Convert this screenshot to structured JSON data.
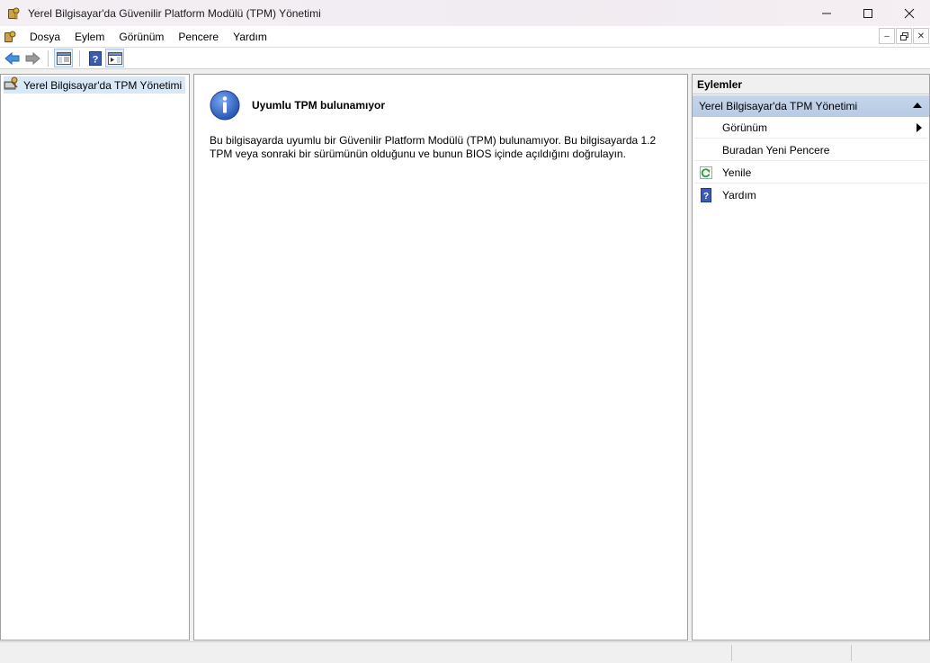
{
  "window": {
    "title": "Yerel Bilgisayar'da Güvenilir Platform Modülü (TPM) Yönetimi",
    "icon": "tpm-key-icon"
  },
  "menu": {
    "items": [
      {
        "label": "Dosya"
      },
      {
        "label": "Eylem"
      },
      {
        "label": "Görünüm"
      },
      {
        "label": "Pencere"
      },
      {
        "label": "Yardım"
      }
    ]
  },
  "toolbar": {
    "buttons": [
      "back-arrow-icon",
      "forward-arrow-icon",
      "show-hide-console-tree-icon",
      "help-icon",
      "show-hide-action-pane-icon"
    ]
  },
  "tree": {
    "root_label": "Yerel Bilgisayar'da TPM Yönetimi"
  },
  "content": {
    "title": "Uyumlu TPM bulunamıyor",
    "body": "Bu bilgisayarda uyumlu bir Güvenilir Platform Modülü (TPM) bulunamıyor. Bu bilgisayarda 1.2 TPM veya sonraki bir sürümünün olduğunu ve bunun BIOS içinde açıldığını doğrulayın."
  },
  "actions": {
    "header": "Eylemler",
    "section_title": "Yerel Bilgisayar'da TPM Yönetimi",
    "items": [
      {
        "label": "Görünüm",
        "icon": "",
        "submenu": true
      },
      {
        "label": "Buradan Yeni Pencere",
        "icon": ""
      },
      {
        "label": "Yenile",
        "icon": "refresh-icon"
      },
      {
        "label": "Yardım",
        "icon": "help-icon"
      }
    ]
  },
  "colors": {
    "selection": "#d9e8f7",
    "section_header": "#c5d5ea",
    "accent_blue": "#2b5aa8"
  }
}
